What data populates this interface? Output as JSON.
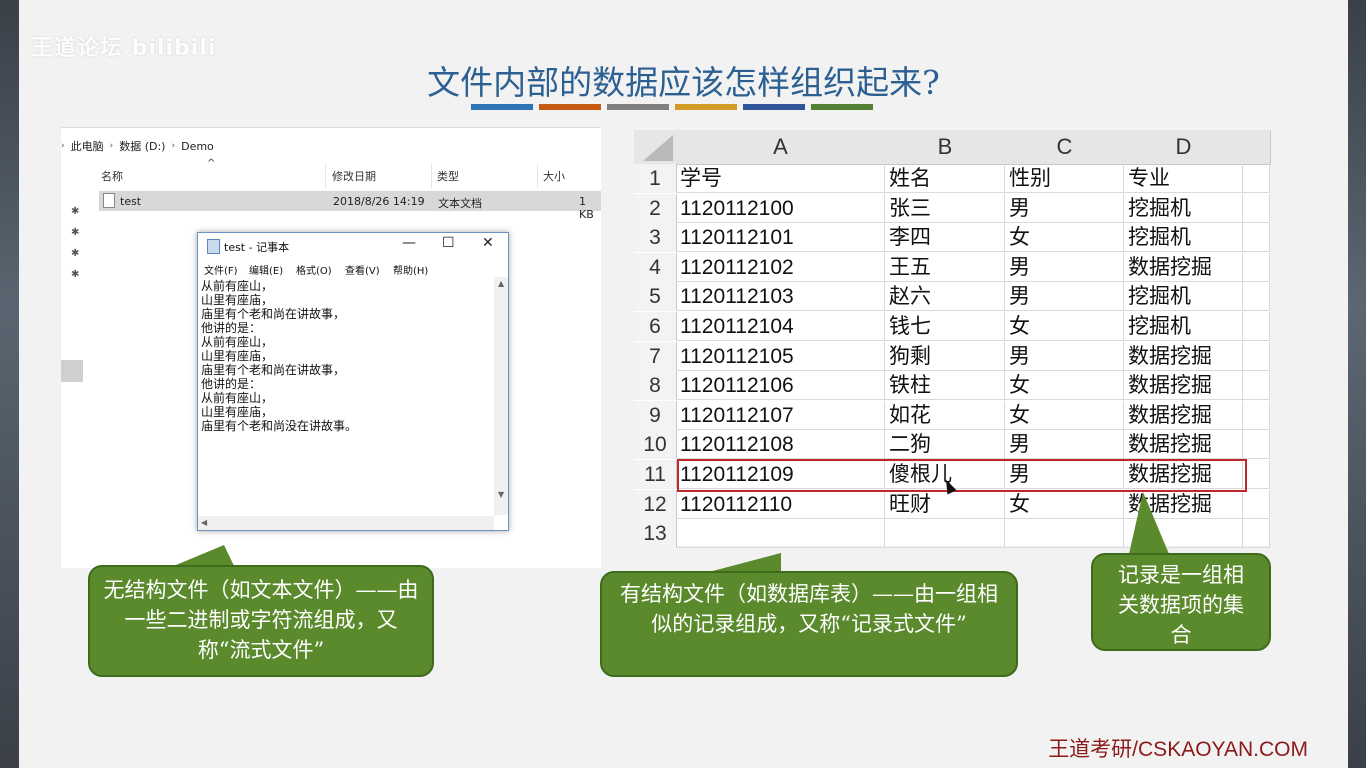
{
  "watermark": "王道论坛 bilibili",
  "title": "文件内部的数据应该怎样组织起来?",
  "title_bar_colors": [
    "#2e75b6",
    "#c55a11",
    "#7f7f7f",
    "#d39b25",
    "#2f5597",
    "#548235"
  ],
  "explorer": {
    "breadcrumb": [
      "此电脑",
      "数据 (D:)",
      "Demo"
    ],
    "columns": [
      "名称",
      "修改日期",
      "类型",
      "大小"
    ],
    "file": {
      "name": "test",
      "modified": "2018/8/26 14:19",
      "type": "文本文档",
      "size": "1 KB"
    }
  },
  "notepad": {
    "title": "test - 记事本",
    "menu": [
      "文件(F)",
      "编辑(E)",
      "格式(O)",
      "查看(V)",
      "帮助(H)"
    ],
    "lines": [
      "从前有座山，",
      "山里有座庙，",
      "庙里有个老和尚在讲故事，",
      "他讲的是：",
      "从前有座山，",
      "山里有座庙，",
      "庙里有个老和尚在讲故事，",
      "他讲的是：",
      "从前有座山，",
      "山里有座庙，",
      "庙里有个老和尚没在讲故事。"
    ]
  },
  "sheet": {
    "columns": [
      "A",
      "B",
      "C",
      "D"
    ],
    "row_numbers": [
      "1",
      "2",
      "3",
      "4",
      "5",
      "6",
      "7",
      "8",
      "9",
      "10",
      "11",
      "12",
      "13"
    ],
    "rows": [
      [
        "学号",
        "姓名",
        "性别",
        "专业"
      ],
      [
        "1120112100",
        "张三",
        "男",
        "挖掘机"
      ],
      [
        "1120112101",
        "李四",
        "女",
        "挖掘机"
      ],
      [
        "1120112102",
        "王五",
        "男",
        "数据挖掘"
      ],
      [
        "1120112103",
        "赵六",
        "男",
        "挖掘机"
      ],
      [
        "1120112104",
        "钱七",
        "女",
        "挖掘机"
      ],
      [
        "1120112105",
        "狗剩",
        "男",
        "数据挖掘"
      ],
      [
        "1120112106",
        "铁柱",
        "女",
        "数据挖掘"
      ],
      [
        "1120112107",
        "如花",
        "女",
        "数据挖掘"
      ],
      [
        "1120112108",
        "二狗",
        "男",
        "数据挖掘"
      ],
      [
        "1120112109",
        "傻根儿",
        "男",
        "数据挖掘"
      ],
      [
        "1120112110",
        "旺财",
        "女",
        "数据挖掘"
      ],
      [
        "",
        "",
        "",
        ""
      ]
    ],
    "highlighted_row": "11"
  },
  "callouts": {
    "unstructured": "无结构文件（如文本文件）——由一些二进制或字符流组成，又称“流式文件”",
    "structured": "有结构文件（如数据库表）——由一组相似的记录组成，又称“记录式文件”",
    "record": "记录是一组相关数据项的集合"
  },
  "footer": "王道考研/CSKAOYAN.COM"
}
